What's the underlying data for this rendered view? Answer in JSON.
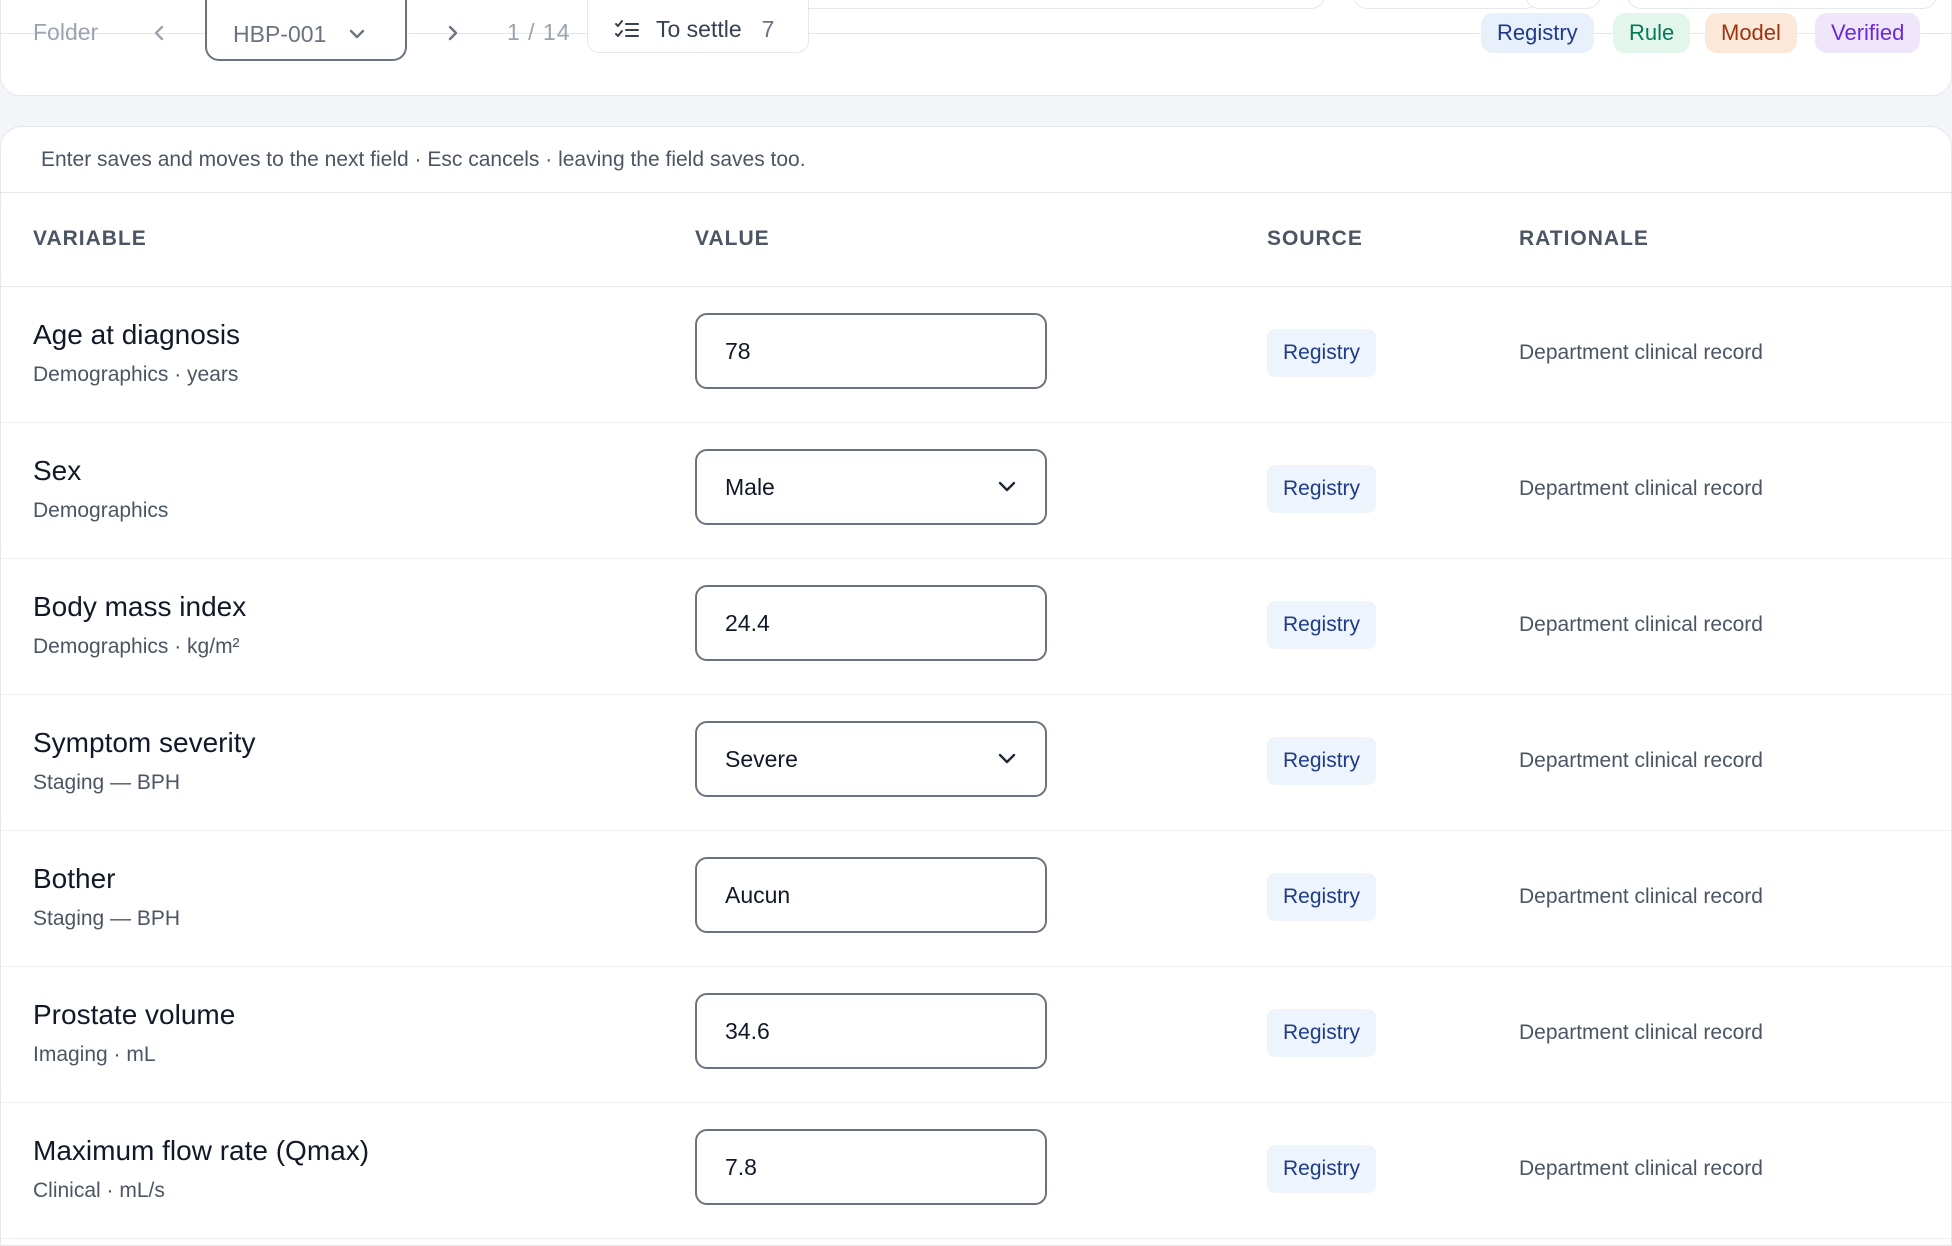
{
  "toolbar": {
    "folder_label": "Folder",
    "case_id": "HBP-001",
    "pager": "1 / 14",
    "settle_label": "To settle",
    "settle_count": "7",
    "legend": [
      {
        "label": "Registry",
        "bg": "#e8f0fb",
        "fg": "#1e3a8a"
      },
      {
        "label": "Rule",
        "bg": "#e3f6ec",
        "fg": "#047857"
      },
      {
        "label": "Model",
        "bg": "#fbe8d8",
        "fg": "#9a3412"
      },
      {
        "label": "Verified",
        "bg": "#efe6fc",
        "fg": "#6d28d9"
      }
    ]
  },
  "hint": "Enter saves and moves to the next field · Esc cancels · leaving the field saves too.",
  "columns": {
    "variable": "VARIABLE",
    "value": "VALUE",
    "source": "SOURCE",
    "rationale": "RATIONALE"
  },
  "rows": [
    {
      "name": "Age at diagnosis",
      "meta": "Demographics · years",
      "value": "78",
      "kind": "input",
      "source": "Registry",
      "rationale": "Department clinical record"
    },
    {
      "name": "Sex",
      "meta": "Demographics",
      "value": "Male",
      "kind": "select",
      "source": "Registry",
      "rationale": "Department clinical record"
    },
    {
      "name": "Body mass index",
      "meta": "Demographics · kg/m²",
      "value": "24.4",
      "kind": "input",
      "source": "Registry",
      "rationale": "Department clinical record"
    },
    {
      "name": "Symptom severity",
      "meta": "Staging — BPH",
      "value": "Severe",
      "kind": "select",
      "source": "Registry",
      "rationale": "Department clinical record"
    },
    {
      "name": "Bother",
      "meta": "Staging — BPH",
      "value": "Aucun",
      "kind": "input",
      "source": "Registry",
      "rationale": "Department clinical record"
    },
    {
      "name": "Prostate volume",
      "meta": "Imaging · mL",
      "value": "34.6",
      "kind": "input",
      "source": "Registry",
      "rationale": "Department clinical record"
    },
    {
      "name": "Maximum flow rate (Qmax)",
      "meta": "Clinical · mL/s",
      "value": "7.8",
      "kind": "input",
      "source": "Registry",
      "rationale": "Department clinical record"
    }
  ]
}
